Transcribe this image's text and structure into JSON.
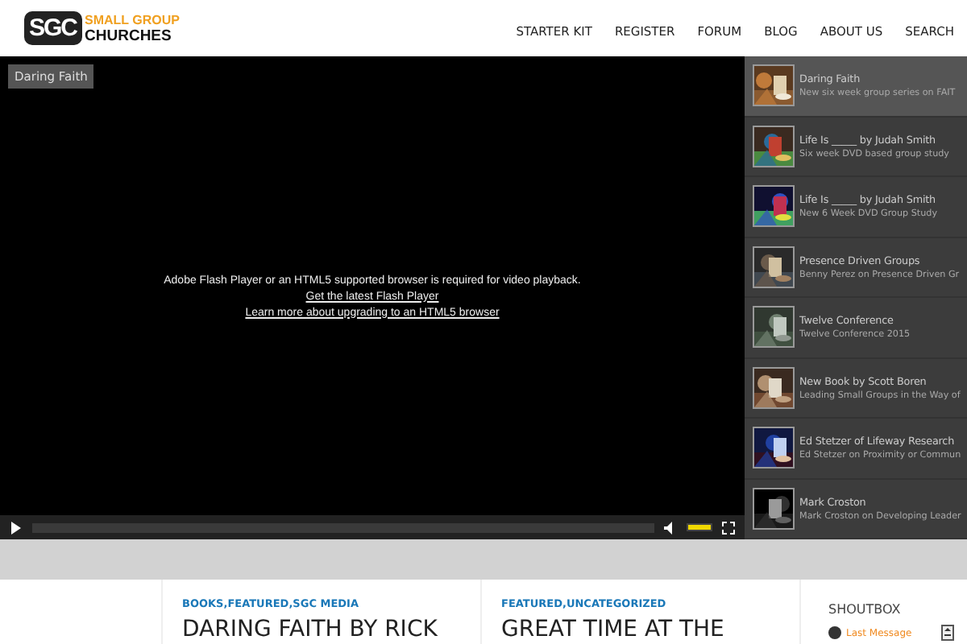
{
  "logo": {
    "mark": "SGC",
    "line1": "SMALL GROUP",
    "line2": "CHURCHES"
  },
  "nav": [
    "STARTER KIT",
    "REGISTER",
    "FORUM",
    "BLOG",
    "ABOUT US",
    "SEARCH"
  ],
  "player": {
    "title": "Daring Faith",
    "message": "Adobe Flash Player or an HTML5 supported browser is required for video playback.",
    "links": [
      "Get the latest Flash Player",
      "Learn more about upgrading to an HTML5 browser"
    ],
    "volume": {
      "level": 1
    }
  },
  "playlist": [
    {
      "title": "Daring Faith",
      "subtitle": "New six week group series on FAIT",
      "selected": true
    },
    {
      "title": "Life Is _____ by Judah Smith",
      "subtitle": "Six week DVD based group study",
      "selected": false
    },
    {
      "title": "Life Is _____ by Judah Smith",
      "subtitle": "New 6 Week DVD Group Study",
      "selected": false
    },
    {
      "title": "Presence Driven Groups",
      "subtitle": "Benny Perez on Presence Driven Gr",
      "selected": false
    },
    {
      "title": "Twelve Conference",
      "subtitle": "Twelve Conference 2015",
      "selected": false
    },
    {
      "title": "New Book by Scott Boren",
      "subtitle": "Leading Small Groups in the Way of",
      "selected": false
    },
    {
      "title": "Ed Stetzer of Lifeway Research",
      "subtitle": "Ed Stetzer on Proximity or Commun",
      "selected": false
    },
    {
      "title": "Mark Croston",
      "subtitle": "Mark Croston on Developing Leader",
      "selected": false
    }
  ],
  "posts": [
    {
      "categories": [
        "BOOKS",
        "FEATURED",
        "SGC MEDIA"
      ],
      "separator": ",",
      "title": "DARING FAITH BY RICK"
    },
    {
      "categories": [
        "FEATURED",
        "UNCATEGORIZED"
      ],
      "separator": ",",
      "title": "GREAT TIME AT THE"
    }
  ],
  "shoutbox": {
    "heading": "SHOUTBOX",
    "link": "Last Message"
  }
}
